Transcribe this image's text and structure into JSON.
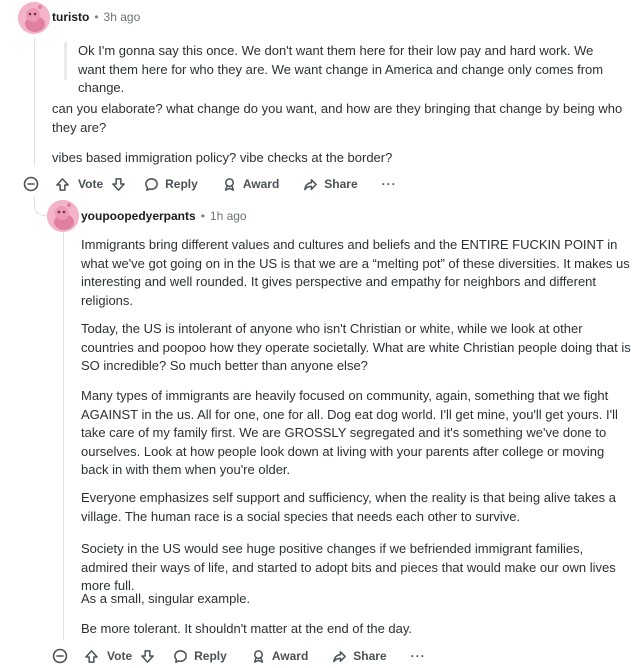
{
  "comment1": {
    "username": "turisto",
    "time": "3h ago",
    "quote": "Ok I'm gonna say this once. We don't want them here for their low pay and hard work. We want them here for who they are. We want change in America and change only comes from change.",
    "paragraphs": [
      "can you elaborate? what change do you want, and how are they bringing that change by being who they are?",
      "vibes based immigration policy? vibe checks at the border?"
    ],
    "actions": {
      "vote": "Vote",
      "reply": "Reply",
      "award": "Award",
      "share": "Share",
      "more": "···"
    }
  },
  "comment2": {
    "username": "youpoopedyerpants",
    "time": "1h ago",
    "paragraphs": [
      "Immigrants bring different values and cultures and beliefs and the ENTIRE FUCKIN POINT in what we've got going on in the US is that we are a “melting pot” of these diversities. It makes us interesting and well rounded. It gives perspective and empathy for neighbors and different religions.",
      "Today, the US is intolerant of anyone who isn't Christian or white, while we look at other countries and poopoo how they operate societally. What are white Christian people doing that is SO incredible? So much better than anyone else?",
      "Many types of immigrants are heavily focused on community, again, something that we fight AGAINST in the us. All for one, one for all. Dog eat dog world. I'll get mine, you'll get yours. I'll take care of my family first. We are GROSSLY segregated and it's something we've done to ourselves. Look at how people look down at living with your parents after college or moving back in with them when you're older.",
      "Everyone emphasizes self support and sufficiency, when the reality is that being alive takes a village. The human race is a social species that needs each other to survive.",
      "Society in the US would see huge positive changes if we befriended immigrant families, admired their ways of life, and started to adopt bits and pieces that would make our own lives more full.",
      "As a small, singular example.",
      "Be more tolerant. It shouldn't matter at the end of the day."
    ],
    "actions": {
      "vote": "Vote",
      "reply": "Reply",
      "award": "Award",
      "share": "Share",
      "more": "···"
    }
  }
}
